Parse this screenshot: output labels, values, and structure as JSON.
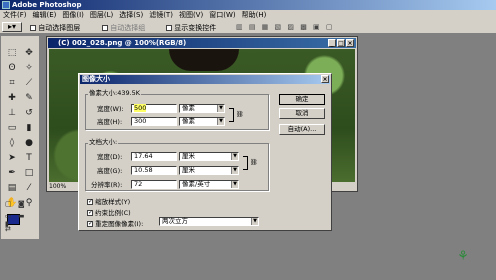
{
  "app": {
    "title": "Adobe Photoshop"
  },
  "menu": [
    "文件(F)",
    "编辑(E)",
    "图像(I)",
    "图层(L)",
    "选择(S)",
    "滤镜(T)",
    "视图(V)",
    "窗口(W)",
    "帮助(H)"
  ],
  "options": {
    "auto_select_layer": "自动选择图层",
    "auto_select_group": "自动选择组",
    "show_transform": "显示变换控件"
  },
  "document": {
    "title": "(C) 002_028.png @ 100%(RGB/8)",
    "zoom": "100%"
  },
  "dialog": {
    "title": "图像大小",
    "pixel_size_label": "像素大小:439.5K",
    "width_label": "宽度(W):",
    "width_value": "500",
    "width_unit": "像素",
    "height_label": "高度(H):",
    "height_value": "300",
    "height_unit": "像素",
    "doc_size_label": "文档大小:",
    "doc_width_label": "宽度(D):",
    "doc_width_value": "17.64",
    "doc_width_unit": "厘米",
    "doc_height_label": "高度(G):",
    "doc_height_value": "10.58",
    "doc_height_unit": "厘米",
    "resolution_label": "分辨率(R):",
    "resolution_value": "72",
    "resolution_unit": "像素/英寸",
    "scale_styles": "缩放样式(Y)",
    "constrain": "约束比例(C)",
    "resample": "重定图像像素(I):",
    "resample_method": "两次立方",
    "ok": "确定",
    "cancel": "取消",
    "auto": "自动(A)..."
  },
  "colors": {
    "titlebar": "#0a246a",
    "chrome": "#d4d0c8",
    "highlight": "#ffff66"
  }
}
